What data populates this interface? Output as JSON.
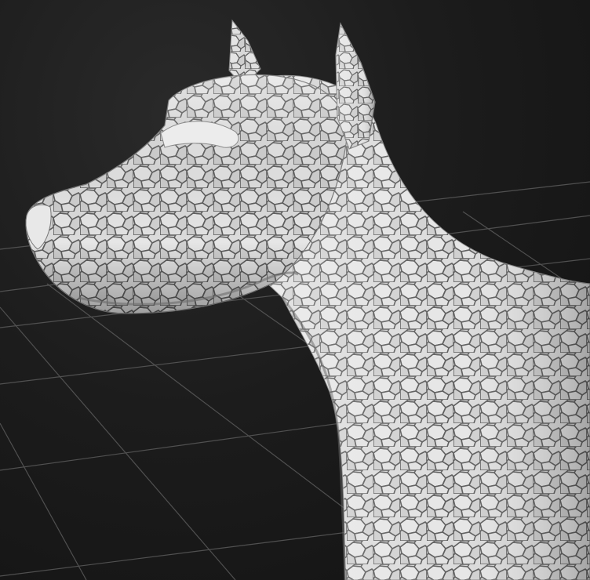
{
  "viewport": {
    "background_color": "#1b1b1b",
    "grid_color": "#5a5a5a",
    "model_color": "#d9d9d9",
    "model_shadow_color": "#8a8a8a",
    "scale_pattern_color": "#5e5e5e",
    "grid_visible": true,
    "model_icon": "dog-sculpt-icon"
  }
}
